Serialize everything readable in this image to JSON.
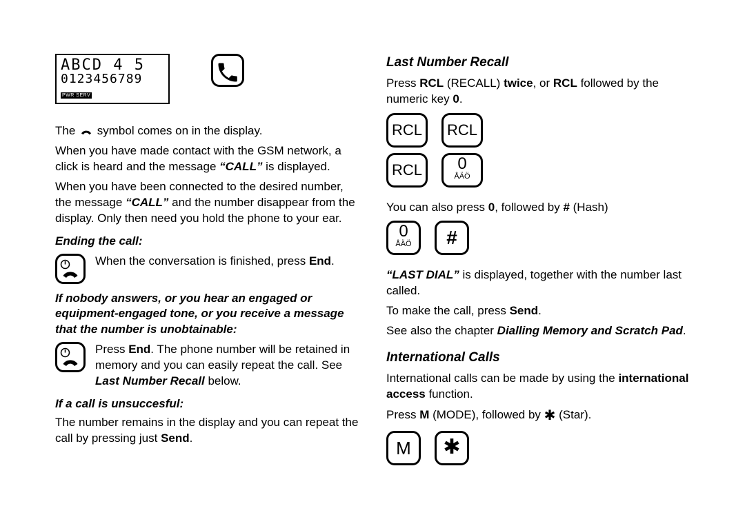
{
  "left": {
    "lcd": {
      "line1": "ABCD  4  5",
      "line2": "0123456789",
      "status": "PWR SERV"
    },
    "p1a": "The ",
    "p1b": " symbol comes on in the display.",
    "p2a": "When you have made contact with the GSM network, a click is heard and the message ",
    "p2call": "“CALL”",
    "p2b": " is displayed.",
    "p3a": "When you have been connected to the desired number, the message ",
    "p3b": " and the number disappear from the display. Only then need you hold the phone to your ear.",
    "h_end": "Ending the call:",
    "end_text_a": "When the conversation is finished, press ",
    "end_text_b": ".",
    "h_nobody": "If nobody answers, or you hear an engaged or equipment-engaged tone, or you receive a message that the number is unobtainable:",
    "nobody_a": "Press ",
    "nobody_b": ". The phone number will be retained in memory and you can easily repeat the call. See ",
    "nobody_ref": "Last Number Recall",
    "nobody_c": " below.",
    "h_unsucc": "If a call is unsuccesful:",
    "unsucc_a": "The number remains in the display and you can repeat the call by pressing just ",
    "unsucc_b": ".",
    "kw": {
      "end": "End",
      "send": "Send"
    }
  },
  "right": {
    "h_last": "Last Number Recall",
    "r1a": "Press ",
    "r1b": " (RECALL) ",
    "r1c": ", or ",
    "r1d": " followed by the numeric key ",
    "r1e": ".",
    "r2a": "You can also press ",
    "r2b": ", followed by ",
    "r2c": " (Hash)",
    "r3last": "“LAST DIAL”",
    "r3a": " is displayed, together with the number last called.",
    "r4a": "To make the call, press ",
    "r4b": ".",
    "r5a": "See also the chapter ",
    "r5ref": "Dialling Memory and Scratch Pad",
    "r5b": ".",
    "h_intl": "International Calls",
    "i1a": "International calls can be made by using the ",
    "i1b": " function.",
    "i2a": "Press ",
    "i2b": " (MODE), followed by ",
    "i2c": " (Star).",
    "kw": {
      "rcl": "RCL",
      "twice": "twice",
      "zero": "0",
      "hash": "#",
      "send": "Send",
      "intlacc": "international access",
      "m": "M",
      "star": "✱"
    },
    "keys": {
      "rcl": "RCL",
      "zero": "0",
      "zero_sub": "ÅÄÖ",
      "hash": "#",
      "m": "M",
      "star": "✱"
    }
  }
}
